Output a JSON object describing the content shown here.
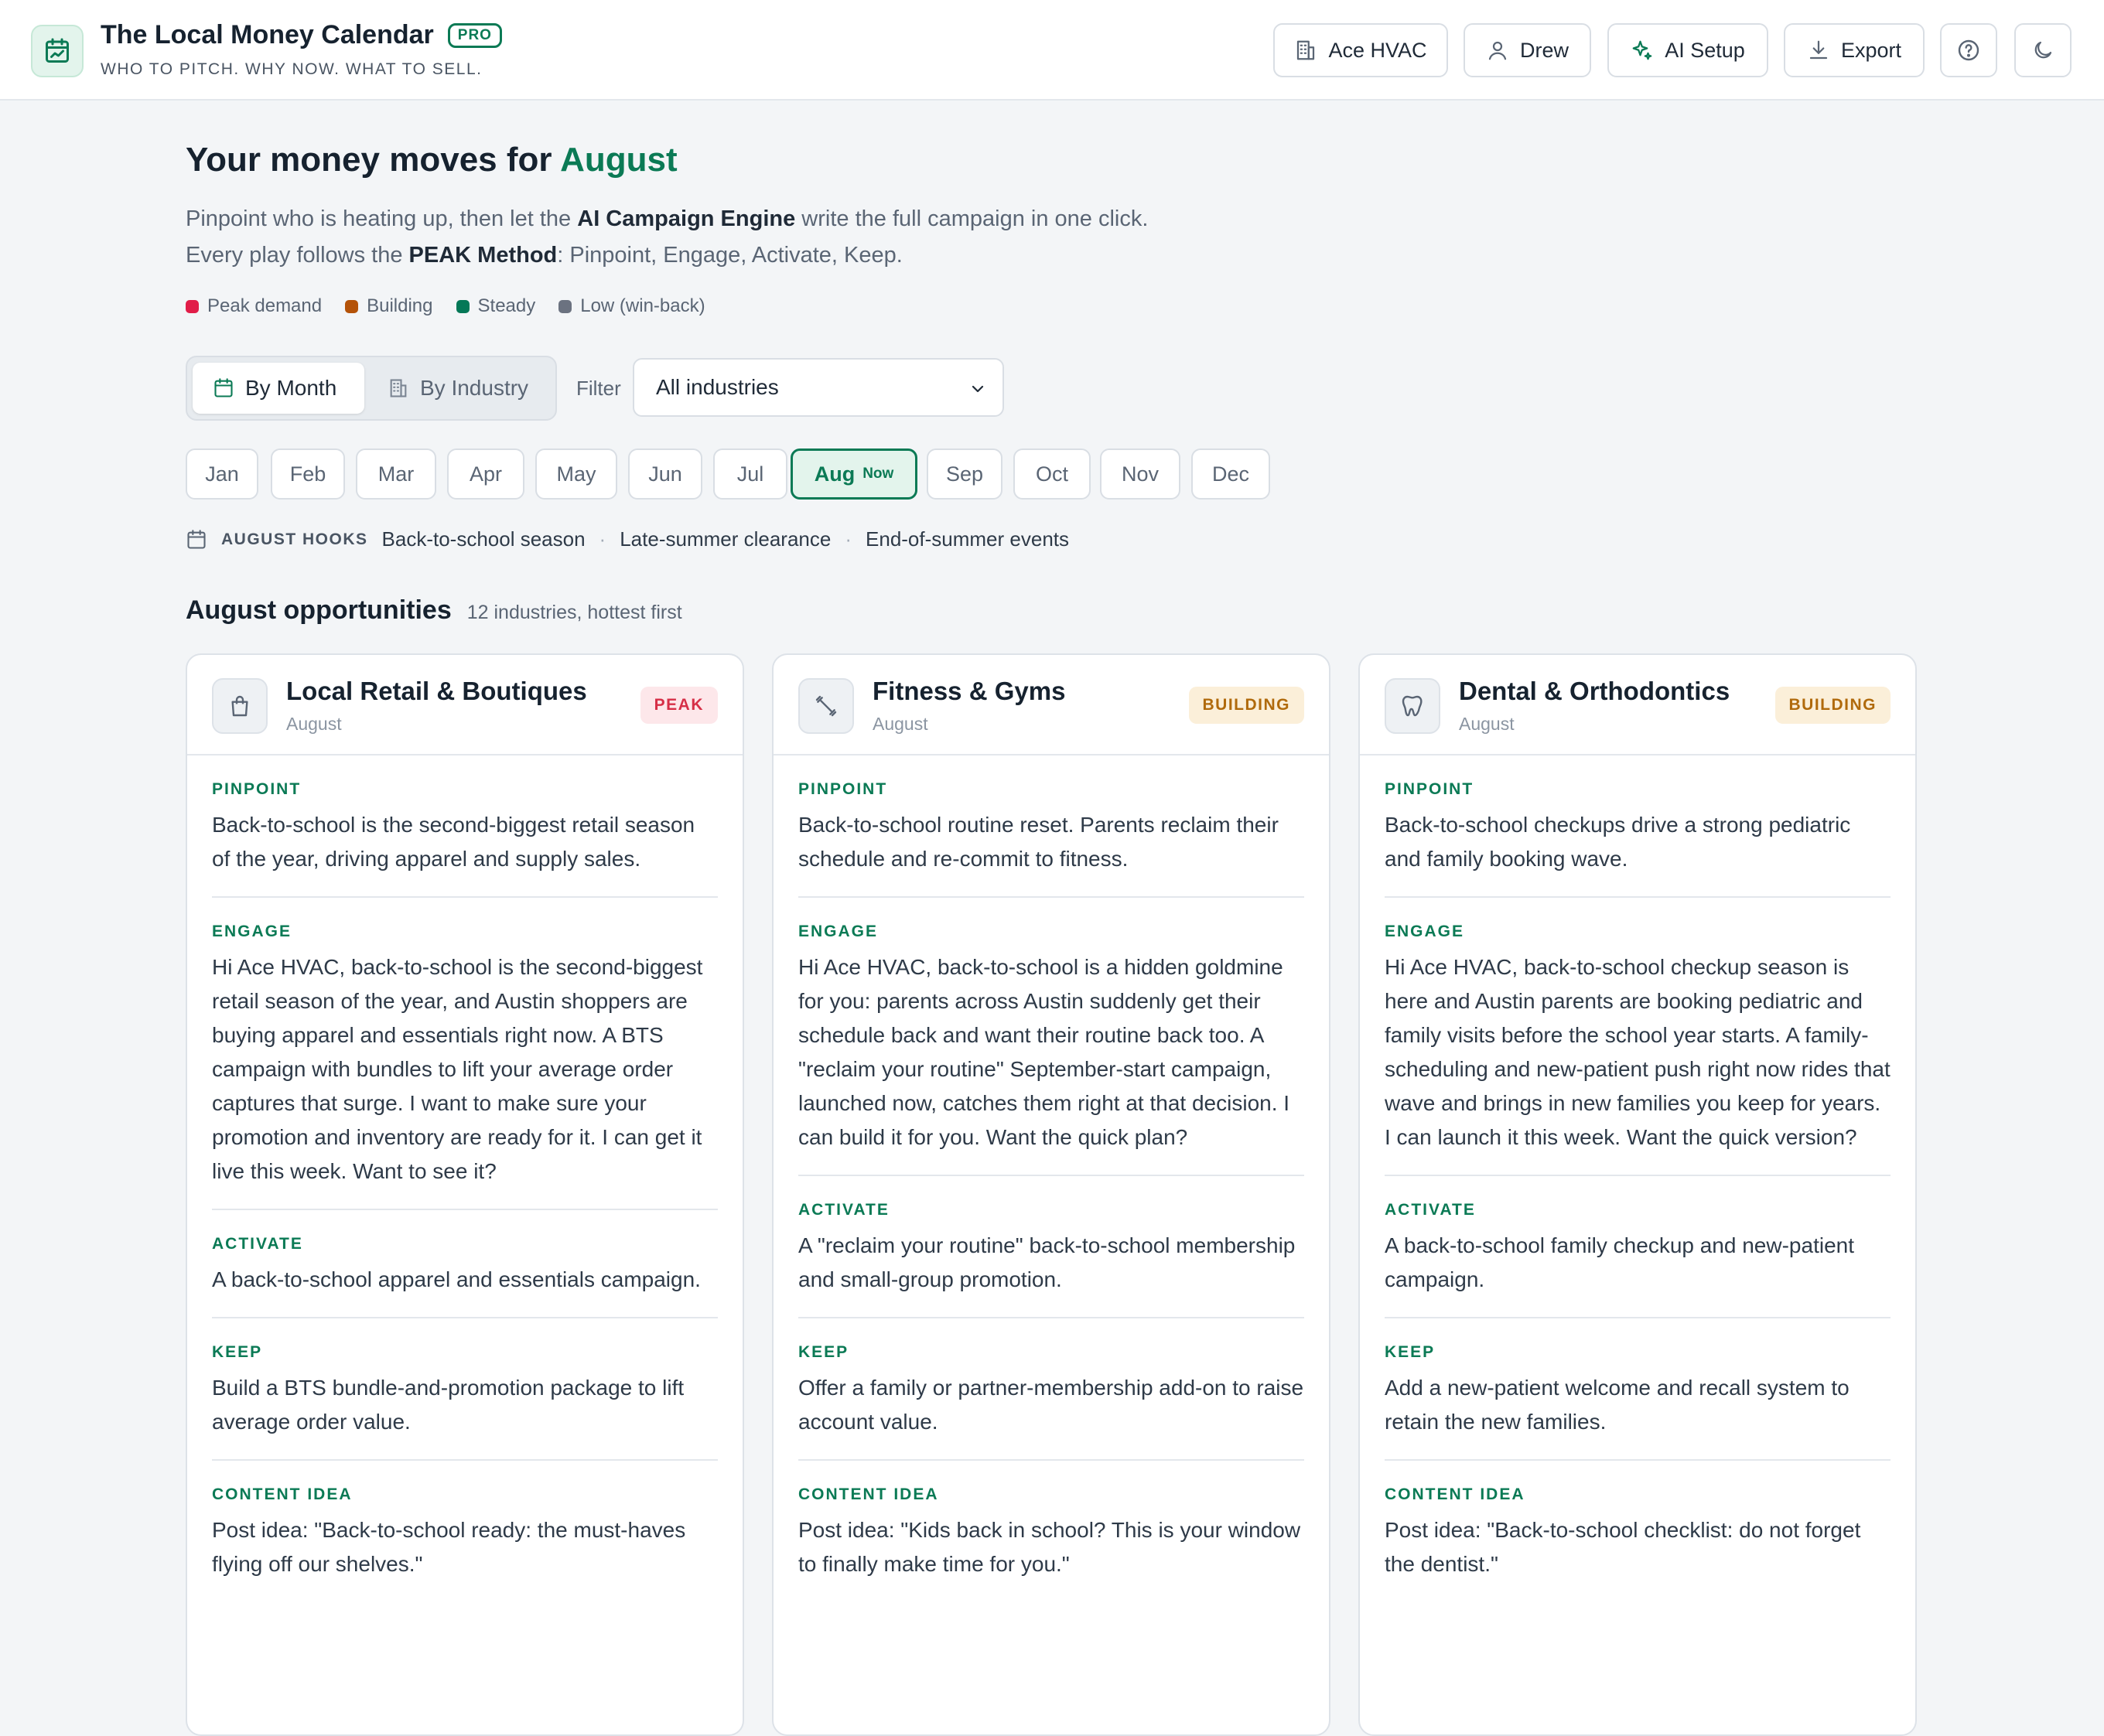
{
  "header": {
    "app_title": "The Local Money Calendar",
    "pro_badge": "PRO",
    "tagline": "WHO TO PITCH. WHY NOW. WHAT TO SELL.",
    "buttons": {
      "business": "Ace HVAC",
      "user": "Drew",
      "ai_setup": "AI Setup",
      "export": "Export"
    }
  },
  "hero": {
    "title_prefix": "Your money moves for",
    "title_month": "August",
    "line1_prefix": "Pinpoint who is heating up, then let the",
    "line1_bold": "AI Campaign Engine",
    "line1_suffix": "write the full campaign in one click.",
    "line2_prefix": "Every play follows the",
    "line2_bold": "PEAK Method",
    "line2_suffix": ": Pinpoint, Engage, Activate, Keep."
  },
  "legend": [
    {
      "label": "Peak demand",
      "color": "#e11d48"
    },
    {
      "label": "Building",
      "color": "#b45309"
    },
    {
      "label": "Steady",
      "color": "#047857"
    },
    {
      "label": "Low (win-back)",
      "color": "#6b7280"
    }
  ],
  "view_toggle": {
    "by_month": "By Month",
    "by_industry": "By Industry",
    "active": "By Month"
  },
  "filter": {
    "label": "Filter",
    "value": "All industries"
  },
  "months": [
    "Jan",
    "Feb",
    "Mar",
    "Apr",
    "May",
    "Jun",
    "Jul",
    "Aug",
    "Sep",
    "Oct",
    "Nov",
    "Dec"
  ],
  "current_month": "Aug",
  "now_label": "Now",
  "hooks": {
    "label": "AUGUST HOOKS",
    "items": [
      "Back-to-school season",
      "Late-summer clearance",
      "End-of-summer events"
    ]
  },
  "opportunities": {
    "title": "August opportunities",
    "subtitle": "12 industries, hottest first"
  },
  "cards": [
    {
      "title": "Local Retail & Boutiques",
      "month": "August",
      "status": "PEAK",
      "icon": "shopping-bag-icon",
      "sections": [
        {
          "label": "PINPOINT",
          "text": "Back-to-school is the second-biggest retail season of the year, driving apparel and supply sales."
        },
        {
          "label": "ENGAGE",
          "text": "Hi Ace HVAC, back-to-school is the second-biggest retail season of the year, and Austin shoppers are buying apparel and essentials right now. A BTS campaign with bundles to lift your average order captures that surge. I want to make sure your promotion and inventory are ready for it. I can get it live this week. Want to see it?"
        },
        {
          "label": "ACTIVATE",
          "text": "A back-to-school apparel and essentials campaign."
        },
        {
          "label": "KEEP",
          "text": "Build a BTS bundle-and-promotion package to lift average order value."
        },
        {
          "label": "CONTENT IDEA",
          "text": "Post idea: \"Back-to-school ready: the must-haves flying off our shelves.\""
        }
      ]
    },
    {
      "title": "Fitness & Gyms",
      "month": "August",
      "status": "BUILDING",
      "icon": "dumbbell-icon",
      "sections": [
        {
          "label": "PINPOINT",
          "text": "Back-to-school routine reset. Parents reclaim their schedule and re-commit to fitness."
        },
        {
          "label": "ENGAGE",
          "text": "Hi Ace HVAC, back-to-school is a hidden goldmine for you: parents across Austin suddenly get their schedule back and want their routine back too. A \"reclaim your routine\" September-start campaign, launched now, catches them right at that decision. I can build it for you. Want the quick plan?"
        },
        {
          "label": "ACTIVATE",
          "text": "A \"reclaim your routine\" back-to-school membership and small-group promotion."
        },
        {
          "label": "KEEP",
          "text": "Offer a family or partner-membership add-on to raise account value."
        },
        {
          "label": "CONTENT IDEA",
          "text": "Post idea: \"Kids back in school? This is your window to finally make time for you.\""
        }
      ]
    },
    {
      "title": "Dental & Orthodontics",
      "month": "August",
      "status": "BUILDING",
      "icon": "tooth-icon",
      "sections": [
        {
          "label": "PINPOINT",
          "text": "Back-to-school checkups drive a strong pediatric and family booking wave."
        },
        {
          "label": "ENGAGE",
          "text": "Hi Ace HVAC, back-to-school checkup season is here and Austin parents are booking pediatric and family visits before the school year starts. A family-scheduling and new-patient push right now rides that wave and brings in new families you keep for years. I can launch it this week. Want the quick version?"
        },
        {
          "label": "ACTIVATE",
          "text": "A back-to-school family checkup and new-patient campaign."
        },
        {
          "label": "KEEP",
          "text": "Add a new-patient welcome and recall system to retain the new families."
        },
        {
          "label": "CONTENT IDEA",
          "text": "Post idea: \"Back-to-school checklist: do not forget the dentist.\""
        }
      ]
    }
  ]
}
